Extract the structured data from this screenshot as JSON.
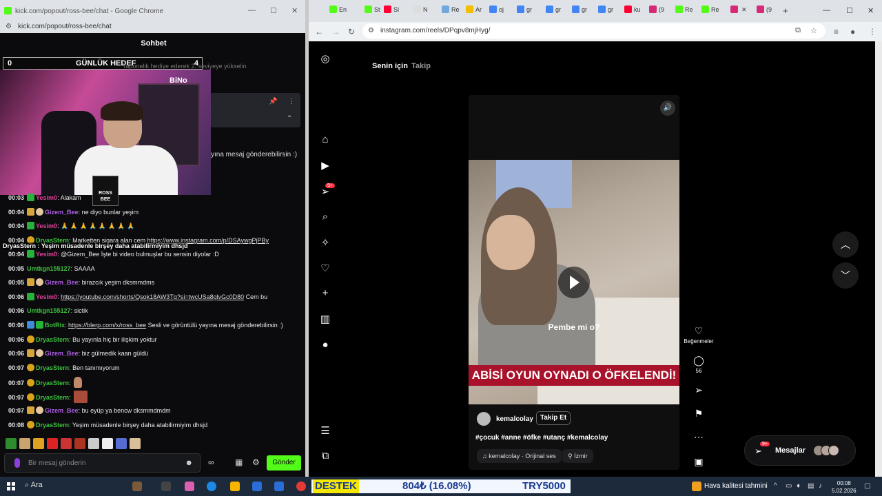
{
  "left_window": {
    "title": "kick.com/popout/ross-bee/chat - Google Chrome",
    "url": "kick.com/popout/ross-bee/chat",
    "chat_header": "Sohbet",
    "goal": {
      "left": "0",
      "label": "GÜNLÜK HEDEF",
      "right": "4"
    },
    "goal_hint": "Taponelik hediye ederek 2. seviyeye yükselin",
    "webcam_logo": "BiNo",
    "webcam_badge": "ROSS BEE",
    "overflow_msg": "yına mesaj gönderebilirsin :)",
    "pinned_overlay": "DryasStern : Yeşim müsadenle birşey daha atabilirmiyim dhsjd",
    "messages": [
      {
        "time": "00:03",
        "badges": [
          "green"
        ],
        "user": "Yesim0",
        "color": "#e0409a",
        "text": ": Alakam"
      },
      {
        "time": "00:04",
        "badges": [
          "crown",
          "hand"
        ],
        "user": "Gizem_Bee",
        "color": "#b05ee8",
        "text": ": ne diyo bunlar yeşim"
      },
      {
        "time": "00:04",
        "badges": [
          "green"
        ],
        "user": "Yesim0",
        "color": "#e0409a",
        "text": ": 🙏 🙏 🙏 🙏 🙏 🙏 🙏 🙏"
      },
      {
        "time": "00:04",
        "badges": [
          "gold"
        ],
        "user": "DryasStern",
        "color": "#3cc23c",
        "text": ": Marketten sigara alan cem ",
        "link": "https://www.instagram.com/p/DSAywgPjPBy"
      },
      {
        "time": "00:04",
        "badges": [
          "green"
        ],
        "user": "Yesim0",
        "color": "#e0409a",
        "text": ": @Gizem_Bee İşte bi video bulmuşlar bu sensin diyolar :D"
      },
      {
        "time": "00:05",
        "badges": [],
        "user": "Umtkgn155127",
        "color": "#3cc23c",
        "text": ": SAAAA"
      },
      {
        "time": "00:05",
        "badges": [
          "crown",
          "hand"
        ],
        "user": "Gizem_Bee",
        "color": "#b05ee8",
        "text": ": birazcık yeşim dksmmdms"
      },
      {
        "time": "00:06",
        "badges": [
          "green"
        ],
        "user": "Yesim0",
        "color": "#e0409a",
        "text": ": ",
        "link": "https://youtube.com/shorts/Qsok18AW3Tg?si=twcUSa8glvGc0D80",
        "after": " Cem bu"
      },
      {
        "time": "00:06",
        "badges": [],
        "user": "Umtkgn155127",
        "color": "#3cc23c",
        "text": ": sictik"
      },
      {
        "time": "00:06",
        "badges": [
          "blue",
          "green"
        ],
        "user": "BotRix",
        "color": "#3cc23c",
        "text": ": ",
        "link": "https://blerp.com/x/ross_bee",
        "after": " Sesli ve görüntülü yayına mesaj gönderebilirsin :)"
      },
      {
        "time": "00:06",
        "badges": [
          "gold"
        ],
        "user": "DryasStern",
        "color": "#3cc23c",
        "text": ": Bu yayınla hiç bir ilişkim yoktur"
      },
      {
        "time": "00:06",
        "badges": [
          "crown",
          "hand"
        ],
        "user": "Gizem_Bee",
        "color": "#b05ee8",
        "text": ": biz gülmedik kaan güldü"
      },
      {
        "time": "00:07",
        "badges": [
          "gold"
        ],
        "user": "DryasStern",
        "color": "#3cc23c",
        "text": ": Ben tanımıyorum"
      },
      {
        "time": "00:07",
        "badges": [
          "gold"
        ],
        "user": "DryasStern",
        "color": "#3cc23c",
        "text": ":",
        "emote": "small"
      },
      {
        "time": "00:07",
        "badges": [
          "gold"
        ],
        "user": "DryasStern",
        "color": "#3cc23c",
        "text": ":",
        "emote": "big"
      },
      {
        "time": "00:07",
        "badges": [
          "crown",
          "hand"
        ],
        "user": "Gizem_Bee",
        "color": "#b05ee8",
        "text": ": bu eyüp ya bencw dksmmdmdm"
      },
      {
        "time": "00:08",
        "badges": [
          "gold"
        ],
        "user": "DryasStern",
        "color": "#3cc23c",
        "text": ": Yeşim müsadenle birşey daha atabilirmiyim dhsjd"
      }
    ],
    "input_placeholder": "Bir mesaj gönderin",
    "send_label": "Gönder"
  },
  "browser": {
    "tabs": [
      {
        "label": "En",
        "color": "#53fc18"
      },
      {
        "label": "St",
        "color": "#53fc18"
      },
      {
        "label": "Sl",
        "color": "#ff0033"
      },
      {
        "label": "N",
        "color": "#dddddd"
      },
      {
        "label": "Re",
        "color": "#6fa8dc"
      },
      {
        "label": "Ar",
        "color": "#f0c000"
      },
      {
        "label": "oj",
        "color": "#4285f4"
      },
      {
        "label": "gr",
        "color": "#4285f4"
      },
      {
        "label": "gr",
        "color": "#4285f4"
      },
      {
        "label": "gr",
        "color": "#4285f4"
      },
      {
        "label": "gr",
        "color": "#4285f4"
      },
      {
        "label": "ku",
        "color": "#ff0033"
      },
      {
        "label": "(9",
        "color": "#d62976"
      },
      {
        "label": "Re",
        "color": "#53fc18"
      },
      {
        "label": "Re",
        "color": "#53fc18"
      },
      {
        "label": "",
        "color": "#d62976"
      },
      {
        "label": "(9",
        "color": "#d62976"
      }
    ],
    "url": "instagram.com/reels/DPqpv8mjHyg/"
  },
  "instagram": {
    "tab_active": "Senin için",
    "tab_inactive": "Takip",
    "notif_badge": "9+",
    "reel_caption": "Pembe mi o?",
    "reel_banner": "ABİSİ OYUN OYNADI O ÖFKELENDİ!",
    "username": "kemalcolay",
    "follow_label": "Takip Et",
    "hashtags": "#çocuk #anne #öfke #utanç #kemalcolay",
    "audio": "kemalcolay · Orijinal ses",
    "location": "İzmir",
    "like_label": "Beğenmeler",
    "comment_count": "56",
    "messages_label": "Mesajlar",
    "messages_badge": "9+"
  },
  "taskbar": {
    "search": "Ara",
    "ticker_destek": "DESTEK",
    "ticker_price": "804₺ (16.08%)",
    "ticker_target": "TRY5000",
    "weather": "Hava kalitesi tahmini",
    "time": "00:08",
    "date": "5.02.2026"
  }
}
